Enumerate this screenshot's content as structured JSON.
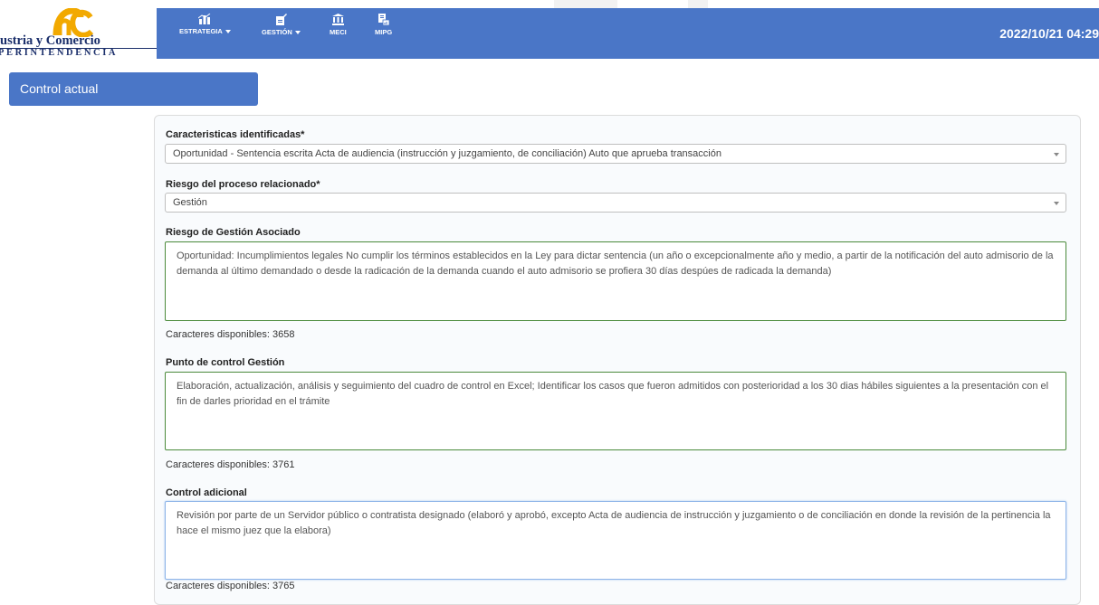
{
  "header": {
    "logo": {
      "line1": "ustria y Comercio",
      "line2": "PERINTENDENCIA"
    },
    "nav": [
      {
        "label": "ESTRATEGIA",
        "icon": "chart-bars-icon",
        "has_dropdown": true
      },
      {
        "label": "GESTIÓN",
        "icon": "document-edit-icon",
        "has_dropdown": true
      },
      {
        "label": "MECI",
        "icon": "institution-icon",
        "has_dropdown": false
      },
      {
        "label": "MIPG",
        "icon": "file-chart-icon",
        "has_dropdown": false
      }
    ],
    "datetime": "2022/10/21 04:29"
  },
  "section_tab": "Control actual",
  "form": {
    "caracteristicas": {
      "label": "Caracteristicas identificadas*",
      "value": "Oportunidad - Sentencia escrita Acta de audiencia (instrucción y juzgamiento, de conciliación) Auto que aprueba transacción"
    },
    "riesgo_proceso": {
      "label": "Riesgo del proceso relacionado*",
      "value": "Gestión"
    },
    "riesgo_gestion": {
      "label": "Riesgo de Gestión Asociado",
      "text": "Oportunidad: Incumplimientos legales No cumplir los términos establecidos en la Ley para dictar sentencia (un año o excepcionalmente año y medio,  a partir de la notificación del auto admisorio de la demanda al último demandado o desde la radicación de la demanda cuando el auto admisorio se profiera 30 días despúes de radicada la demanda)",
      "chars": "Caracteres disponibles: 3658"
    },
    "punto_control": {
      "label": "Punto de control Gestión",
      "text": "Elaboración, actualización, análisis y seguimiento del cuadro de control en Excel; Identificar los casos que fueron admitidos con posterioridad a los 30 dias hábiles siguientes a la presentación con el fin de darles prioridad en el trámite",
      "chars": "Caracteres disponibles: 3761"
    },
    "control_adicional": {
      "label": "Control adicional",
      "text": "Revisión por parte de un Servidor público o contratista designado (elaboró y aprobó, excepto Acta de audiencia de instrucción y juzgamiento o de conciliación en donde la revisión de la pertinencia  la hace el mismo juez que la elabora)",
      "chars": "Caracteres disponibles: 3765"
    }
  },
  "colors": {
    "nav_bg": "#4a76c7",
    "textarea_border": "#4a8a3a",
    "focus_border": "#8db4e8"
  }
}
